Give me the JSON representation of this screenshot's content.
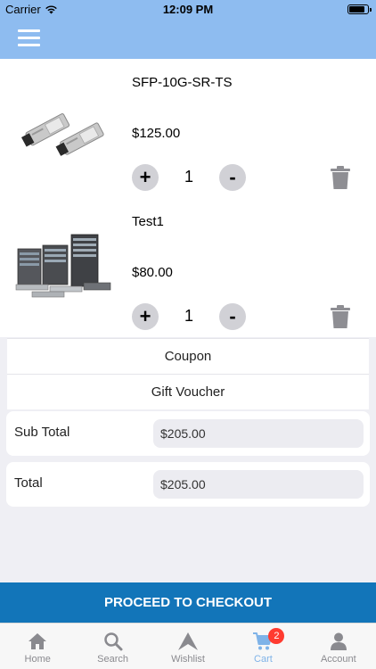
{
  "status": {
    "carrier": "Carrier",
    "time": "12:09 PM"
  },
  "items": [
    {
      "name": "SFP-10G-SR-TS",
      "price": "$125.00",
      "qty": "1",
      "plus": "+",
      "minus": "-"
    },
    {
      "name": "Test1",
      "price": "$80.00",
      "qty": "1",
      "plus": "+",
      "minus": "-"
    }
  ],
  "coupon_label": "Coupon",
  "voucher_label": "Gift Voucher",
  "subtotal": {
    "label": "Sub Total",
    "value": "$205.00"
  },
  "total": {
    "label": "Total",
    "value": "$205.00"
  },
  "checkout_label": "PROCEED TO CHECKOUT",
  "tabs": [
    {
      "label": "Home",
      "icon": "home-icon"
    },
    {
      "label": "Search",
      "icon": "search-icon"
    },
    {
      "label": "Wishlist",
      "icon": "wishlist-icon"
    },
    {
      "label": "Cart",
      "icon": "cart-icon",
      "badge": "2"
    },
    {
      "label": "Account",
      "icon": "account-icon"
    }
  ],
  "colors": {
    "navbar": "#8ebcf0",
    "checkout": "#1275b9",
    "active_tab": "#7fb3e8",
    "badge": "#ff3b30"
  }
}
